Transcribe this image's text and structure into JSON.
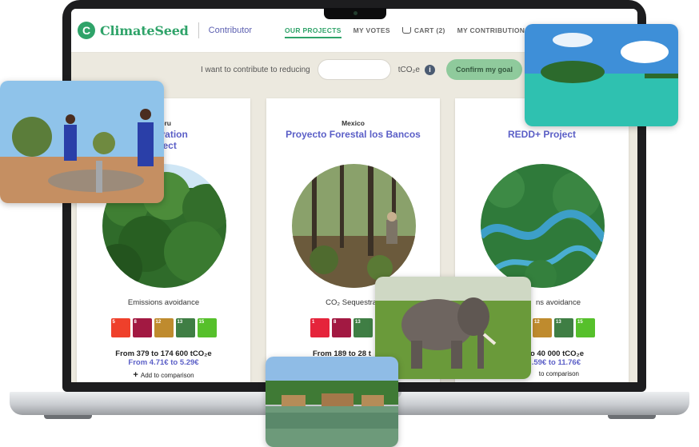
{
  "header": {
    "logo_text": "ClimateSeed",
    "logo_mark": "C",
    "role": "Contributor",
    "nav": [
      {
        "label": "OUR PROJECTS",
        "active": true
      },
      {
        "label": "MY VOTES",
        "active": false
      },
      {
        "label": "CART (2)",
        "active": false,
        "icon": "cart-icon"
      },
      {
        "label": "MY CONTRIBUTIONS",
        "active": false
      }
    ]
  },
  "goal": {
    "prompt": "I want to contribute to reducing",
    "input_value": "",
    "unit": "tCO₂e",
    "confirm_label": "Confirm my goal"
  },
  "cards": [
    {
      "country": "Peru",
      "title": "nservation\nroject",
      "project_type": "Emissions avoidance",
      "range": "From 379 to 174 600 tCO₂e",
      "price": "From 4.71€ to 5.29€",
      "compare": "Add to comparison",
      "sdgs": [
        {
          "n": "5",
          "color": "#ef402b"
        },
        {
          "n": "8",
          "color": "#a21942"
        },
        {
          "n": "12",
          "color": "#bf8b2e"
        },
        {
          "n": "13",
          "color": "#3f7e44"
        },
        {
          "n": "15",
          "color": "#56c02b"
        }
      ]
    },
    {
      "country": "Mexico",
      "title": "Proyecto Forestal los Bancos",
      "project_type": "CO₂ Sequestrati",
      "range": "From 189 to 28 t",
      "price": "",
      "compare": "",
      "sdgs": [
        {
          "n": "1",
          "color": "#e5243b"
        },
        {
          "n": "8",
          "color": "#a21942"
        },
        {
          "n": "13",
          "color": "#3f7e44"
        }
      ]
    },
    {
      "country": "",
      "title": "REDD+ Project",
      "project_type": "ns avoidance",
      "range": "o 40 000 tCO₂e",
      "price": ".59€ to 11.76€",
      "compare": "to comparison",
      "sdgs": [
        {
          "n": "12",
          "color": "#bf8b2e"
        },
        {
          "n": "13",
          "color": "#3f7e44"
        },
        {
          "n": "15",
          "color": "#56c02b"
        }
      ]
    }
  ],
  "colors": {
    "brand_green": "#2fa369",
    "accent_purple": "#5b5fc7",
    "confirm_bg": "#8fca9c"
  }
}
